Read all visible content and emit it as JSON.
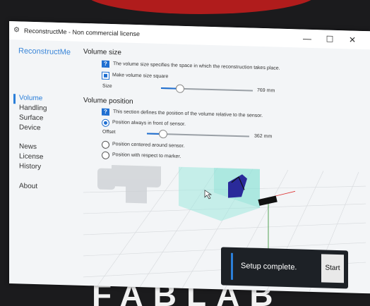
{
  "window": {
    "title": "ReconstructMe - Non commercial license",
    "controls": [
      "—",
      "☐",
      "✕"
    ]
  },
  "sidebar": {
    "brand": "ReconstructMe",
    "items": [
      {
        "label": "Volume",
        "active": true
      },
      {
        "label": "Handling"
      },
      {
        "label": "Surface"
      },
      {
        "label": "Device"
      },
      {
        "label": "News"
      },
      {
        "label": "License"
      },
      {
        "label": "History"
      },
      {
        "label": "About"
      }
    ]
  },
  "volume_size": {
    "title": "Volume size",
    "help": "?",
    "description": "The volume size specifies the space in which the reconstruction takes place.",
    "square_checkbox": {
      "label": "Make volume size square",
      "checked": true
    },
    "size_slider": {
      "label": "Size",
      "value_text": "769 mm",
      "fraction": 0.2
    }
  },
  "volume_position": {
    "title": "Volume position",
    "help": "?",
    "description": "This section defines the position of the volume relative to the sensor.",
    "options": [
      {
        "label": "Position always in front of sensor.",
        "checked": true
      },
      {
        "label": "Position centered around sensor.",
        "checked": false
      },
      {
        "label": "Position with respect to marker.",
        "checked": false
      }
    ],
    "offset_slider": {
      "label": "Offset",
      "value_text": "362 mm",
      "fraction": 0.15
    }
  },
  "toast": {
    "message": "Setup complete.",
    "button": "Start"
  },
  "background": {
    "sign_text": "FABLAB",
    "accent": "#b01c1c"
  },
  "colors": {
    "accent": "#1f6fd1",
    "toast_bg": "#1d2126",
    "volume_box": "#9ee8de"
  }
}
